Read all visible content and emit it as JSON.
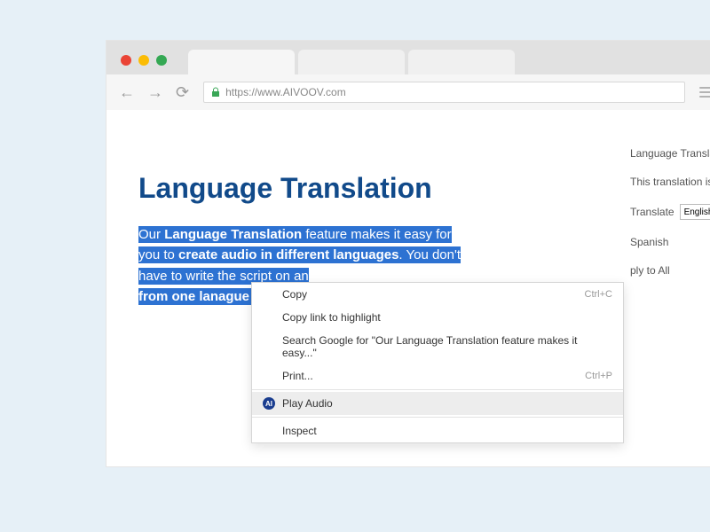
{
  "browser": {
    "url": "https://www.AIVOOV.com"
  },
  "page": {
    "title": "Language Translation",
    "body": {
      "pre": "Our ",
      "b1": "Language Translation",
      "mid1": " feature makes it easy for you to ",
      "b2": "create audio in different languages",
      "mid2": ". You don't have to write the script on an",
      "tail": "from one lanague to"
    }
  },
  "sidepanel": {
    "head": "Language Transla",
    "note": "This translation is",
    "translate_label": "Translate",
    "lang1": "English",
    "lang2": "Spanish",
    "apply": "ply to All"
  },
  "ctxmenu": {
    "copy": "Copy",
    "copy_sc": "Ctrl+C",
    "copylink": "Copy link to highlight",
    "search": "Search Google for \"Our Language Translation feature makes it easy...\"",
    "print": "Print...",
    "print_sc": "Ctrl+P",
    "play": "Play Audio",
    "inspect": "Inspect",
    "ai_label": "AI"
  }
}
